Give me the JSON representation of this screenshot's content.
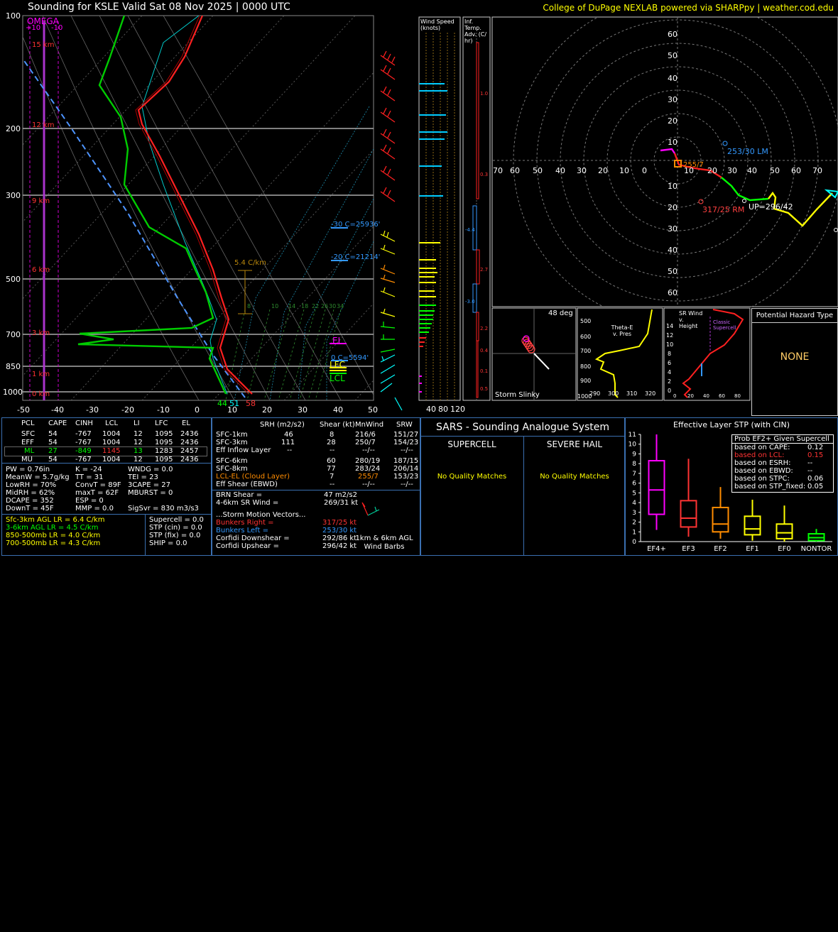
{
  "header": {
    "title": "Sounding for KSLE Valid  Sat 08 Nov 2025 | 0000 UTC",
    "credit": "College of DuPage NEXLAB powered via SHARPpy | weather.cod.edu"
  },
  "skewt": {
    "omega_label": "OMEGA",
    "omega_ticks": [
      "+10",
      "-10"
    ],
    "pressure_ticks": [
      "100",
      "200",
      "300",
      "500",
      "700",
      "850",
      "1000"
    ],
    "temp_ticks": [
      "-50",
      "-40",
      "-30",
      "-20",
      "-10",
      "0",
      "10",
      "20",
      "30",
      "40",
      "50"
    ],
    "height_labels": [
      "15 km",
      "12 km",
      "9 km",
      "6 km",
      "3 km",
      "1 km",
      "0 km"
    ],
    "lapse_label": "5.4 C/km",
    "mixing_ratios": [
      "8",
      "10",
      "14",
      "18",
      "22",
      "26",
      "30",
      "34"
    ],
    "level_labels": [
      {
        "text": "-30 C=25936'",
        "color": "#3399ff"
      },
      {
        "text": "-20 C=21214'",
        "color": "#3399ff"
      },
      {
        "text": "0 C=5594'",
        "color": "#3399ff"
      },
      {
        "text": "EL",
        "color": "#ff00ff"
      },
      {
        "text": "LFC",
        "color": "#ffff00"
      },
      {
        "text": "LCL",
        "color": "#00ff00"
      }
    ],
    "surface_values": [
      {
        "text": "44",
        "color": "#00ff00"
      },
      {
        "text": "51",
        "color": "#00ffff"
      },
      {
        "text": "58",
        "color": "#ff3333"
      }
    ]
  },
  "wind_speed": {
    "title": "Wind Speed (knots)",
    "ticks": [
      "40",
      "80",
      "120"
    ]
  },
  "inf_temp": {
    "title": "Inf. Temp. Adv. (C/ hr)",
    "labels": [
      "1.0",
      "0.3",
      "-4.4",
      "2.7",
      "-3.0",
      "2.2",
      "0.4",
      "0.1",
      "0.5"
    ]
  },
  "hodograph": {
    "rings": [
      "10",
      "20",
      "30",
      "40",
      "50",
      "60"
    ],
    "x_left": [
      "70",
      "60",
      "50",
      "40",
      "30",
      "20",
      "10",
      "0"
    ],
    "x_right": [
      "10",
      "20",
      "30",
      "40",
      "50",
      "60",
      "70"
    ],
    "y_up": [
      "60",
      "50",
      "40",
      "30",
      "20",
      "10"
    ],
    "y_down": [
      "10",
      "20",
      "30",
      "40",
      "50",
      "60"
    ],
    "lm_label": "253/30 LM",
    "rm_label": "317/25 RM",
    "up_label": "UP=296/42",
    "mean_label": "255/7"
  },
  "storm_slinky": {
    "title": "Storm Slinky",
    "deg": "48 deg"
  },
  "theta_e": {
    "title": "Theta-E v. Pres",
    "p_ticks": [
      "500",
      "600",
      "700",
      "800",
      "900",
      "1000"
    ],
    "x_ticks": [
      "290",
      "300",
      "310",
      "320"
    ]
  },
  "sr_wind": {
    "title": "SR Wind v. Height",
    "h_ticks": [
      "14",
      "12",
      "10",
      "8",
      "6",
      "4",
      "2",
      "0"
    ],
    "x_ticks": [
      "0",
      "20",
      "40",
      "60",
      "80"
    ],
    "classic": "Classic Supercell"
  },
  "hazard": {
    "title": "Potential Hazard Type",
    "value": "NONE"
  },
  "parcels": {
    "headers": [
      "PCL",
      "CAPE",
      "CINH",
      "LCL",
      "LI",
      "LFC",
      "EL"
    ],
    "rows": [
      [
        "SFC",
        "54",
        "-767",
        "1004",
        "12",
        "1095",
        "2436"
      ],
      [
        "EFF",
        "54",
        "-767",
        "1004",
        "12",
        "1095",
        "2436"
      ],
      [
        "ML",
        "27",
        "-849",
        "1145",
        "13",
        "1283",
        "2457"
      ],
      [
        "MU",
        "54",
        "-767",
        "1004",
        "12",
        "1095",
        "2436"
      ]
    ]
  },
  "indices": {
    "col1": [
      "PW = 0.76in",
      "MeanW = 5.7g/kg",
      "LowRH = 70%",
      "MidRH = 62%",
      "DCAPE = 352",
      "DownT = 45F"
    ],
    "col2": [
      "K = -24",
      "TT = 31",
      "ConvT = 89F",
      "maxT = 62F",
      "ESP = 0",
      "MMP = 0.0"
    ],
    "col3": [
      "WNDG = 0.0",
      "TEI = 23",
      "3CAPE = 27",
      "MBURST = 0",
      "",
      "SigSvr = 830 m3/s3"
    ]
  },
  "lapse_rates": [
    {
      "text": "Sfc-3km AGL LR = 6.4 C/km",
      "color": "#ffff00"
    },
    {
      "text": "3-6km AGL LR = 4.5 C/km",
      "color": "#00ff00"
    },
    {
      "text": "850-500mb LR = 4.0 C/km",
      "color": "#ffff00"
    },
    {
      "text": "700-500mb LR = 4.3 C/km",
      "color": "#ffff00"
    }
  ],
  "composites": [
    "Supercell = 0.0",
    "STP (cin) = 0.0",
    "STP (fix) = 0.0",
    "SHIP = 0.0"
  ],
  "kinematics": {
    "headers": [
      "SRH (m2/s2)",
      "Shear (kt)",
      "MnWind",
      "SRW"
    ],
    "rows": [
      [
        "SFC-1km",
        "46",
        "8",
        "216/6",
        "151/27"
      ],
      [
        "SFC-3km",
        "111",
        "28",
        "250/7",
        "154/23"
      ],
      [
        "Eff Inflow Layer",
        "--",
        "--",
        "--/--",
        "--/--"
      ],
      [
        "SFC-6km",
        "",
        "60",
        "280/19",
        "187/15"
      ],
      [
        "SFC-8km",
        "",
        "77",
        "283/24",
        "206/14"
      ],
      [
        "LCL-EL (Cloud Layer)",
        "",
        "7",
        "255/7",
        "153/23"
      ],
      [
        "Eff Shear (EBWD)",
        "",
        "--",
        "--/--",
        "--/--"
      ]
    ],
    "brn_shear": "BRN Shear =",
    "brn_shear_val": "47 m2/s2",
    "sr_wind_46": "4-6km SR Wind =",
    "sr_wind_46_val": "269/31 kt",
    "storm_motion": "...Storm Motion Vectors...",
    "motions": [
      {
        "label": "Bunkers Right =",
        "value": "317/25 kt",
        "color": "#ff3333"
      },
      {
        "label": "Bunkers Left =",
        "value": "253/30 kt",
        "color": "#3399ff"
      },
      {
        "label": "Corfidi Downshear =",
        "value": "292/86 kt",
        "color": "#ffffff"
      },
      {
        "label": "Corfidi Upshear =",
        "value": "296/42 kt",
        "color": "#ffffff"
      }
    ],
    "barb_caption": "1km & 6km AGL Wind Barbs"
  },
  "sars": {
    "title": "SARS - Sounding Analogue System",
    "supercell": "SUPERCELL",
    "hail": "SEVERE HAIL",
    "supercell_result": "No Quality Matches",
    "hail_result": "No Quality Matches"
  },
  "stp_panel": {
    "title": "Effective Layer STP (with CIN)",
    "prob_title": "Prob EF2+ Given Supercell",
    "probs": [
      {
        "label": "based on CAPE:",
        "value": "0.12",
        "color": "#ffffff"
      },
      {
        "label": "based on LCL:",
        "value": "0.15",
        "color": "#ff3333"
      },
      {
        "label": "based on ESRH:",
        "value": "--",
        "color": "#ffffff"
      },
      {
        "label": "based on EBWD:",
        "value": "--",
        "color": "#ffffff"
      },
      {
        "label": "based on STPC:",
        "value": "0.06",
        "color": "#ffffff"
      },
      {
        "label": "based on STP_fixed:",
        "value": "0.05",
        "color": "#ffffff"
      }
    ]
  },
  "chart_data": {
    "type": "box",
    "categories": [
      "EF4+",
      "EF3",
      "EF2",
      "EF1",
      "EF0",
      "NONTOR"
    ],
    "y_ticks": [
      "0",
      "1",
      "2",
      "3",
      "4",
      "5",
      "6",
      "7",
      "8",
      "9",
      "10",
      "11"
    ],
    "ylim": [
      0,
      11
    ],
    "boxes": [
      {
        "min": 1.2,
        "q1": 2.8,
        "median": 5.3,
        "q3": 8.3,
        "max": 11.0,
        "color": "#ff00ff"
      },
      {
        "min": 0.5,
        "q1": 1.5,
        "median": 2.4,
        "q3": 4.2,
        "max": 8.5,
        "color": "#ff3333"
      },
      {
        "min": 0.3,
        "q1": 1.0,
        "median": 1.8,
        "q3": 3.5,
        "max": 5.6,
        "color": "#ff8c00"
      },
      {
        "min": 0.1,
        "q1": 0.7,
        "median": 1.3,
        "q3": 2.6,
        "max": 4.3,
        "color": "#ffff00"
      },
      {
        "min": 0.0,
        "q1": 0.3,
        "median": 0.9,
        "q3": 1.8,
        "max": 3.7,
        "color": "#ffff00"
      },
      {
        "min": 0.0,
        "q1": 0.1,
        "median": 0.4,
        "q3": 0.8,
        "max": 1.3,
        "color": "#00ff00"
      }
    ]
  }
}
